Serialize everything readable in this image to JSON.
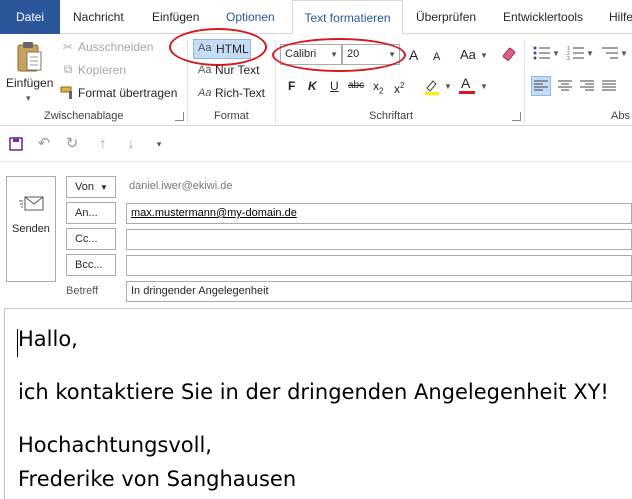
{
  "tabs": {
    "file": "Datei",
    "message": "Nachricht",
    "insert": "Einfügen",
    "options": "Optionen",
    "format_text": "Text formatieren",
    "review": "Überprüfen",
    "developer": "Entwicklertools",
    "help": "Hilfe"
  },
  "clipboard": {
    "paste": "Einfügen",
    "cut": "Ausschneiden",
    "copy": "Kopieren",
    "format_painter": "Format übertragen",
    "group_label": "Zwischenablage"
  },
  "format": {
    "html": "HTML",
    "plain": "Nur Text",
    "rich": "Rich-Text",
    "aa": "Aa",
    "group_label": "Format"
  },
  "font": {
    "name": "Calibri",
    "size": "20",
    "group_label": "Schriftart",
    "bold": "F",
    "italic": "K",
    "underline": "U",
    "strike": "abc",
    "grow": "A",
    "shrink": "A",
    "case": "Aa",
    "font_color": "A"
  },
  "paragraph": {
    "group_label": "Abs"
  },
  "mail": {
    "send": "Senden",
    "from_label": "Von",
    "from_value": "daniel.iwer@ekiwi.de",
    "to_label": "An...",
    "to_value": "max.mustermann@my-domain.de",
    "cc_label": "Cc...",
    "bcc_label": "Bcc...",
    "subject_label": "Betreff",
    "subject_value": "In dringender Angelegenheit"
  },
  "body": {
    "line1": "Hallo,",
    "line2": "ich kontaktiere Sie in der dringenden Angelegenheit XY!",
    "line3": "Hochachtungsvoll,",
    "line4": "Frederike von Sanghausen"
  },
  "colors": {
    "file_tab": "#2b579a",
    "accent_blue": "#2b579a",
    "annotation_red": "#d4191e",
    "selected_bg": "#c5dcf4"
  }
}
